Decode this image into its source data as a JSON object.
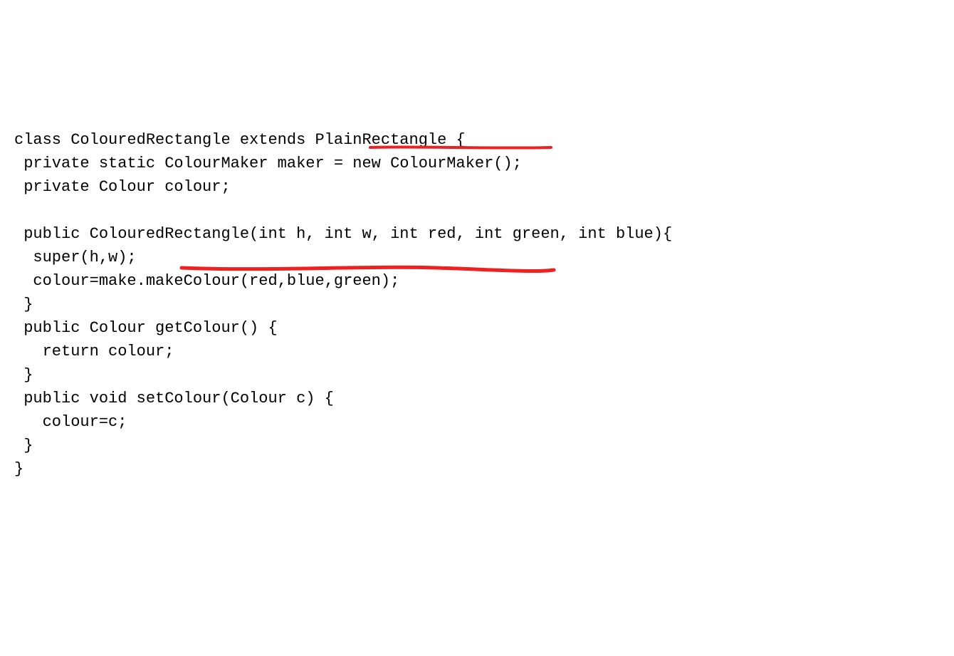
{
  "code": {
    "line1": "class ColouredRectangle extends PlainRectangle {",
    "line2": " private static ColourMaker maker = new ColourMaker();",
    "line3": " private Colour colour;",
    "line4": "",
    "line5": " public ColouredRectangle(int h, int w, int red, int green, int blue){",
    "line6": "  super(h,w);",
    "line7": "  colour=make.makeColour(red,blue,green);",
    "line8": " }",
    "line9": " public Colour getColour() {",
    "line10": "   return colour;",
    "line11": " }",
    "line12": " public void setColour(Colour c) {",
    "line13": "   colour=c;",
    "line14": " }",
    "line15": "}"
  },
  "annotations": {
    "underline1_color": "#ee2020",
    "underline2_color": "#ee2020"
  }
}
